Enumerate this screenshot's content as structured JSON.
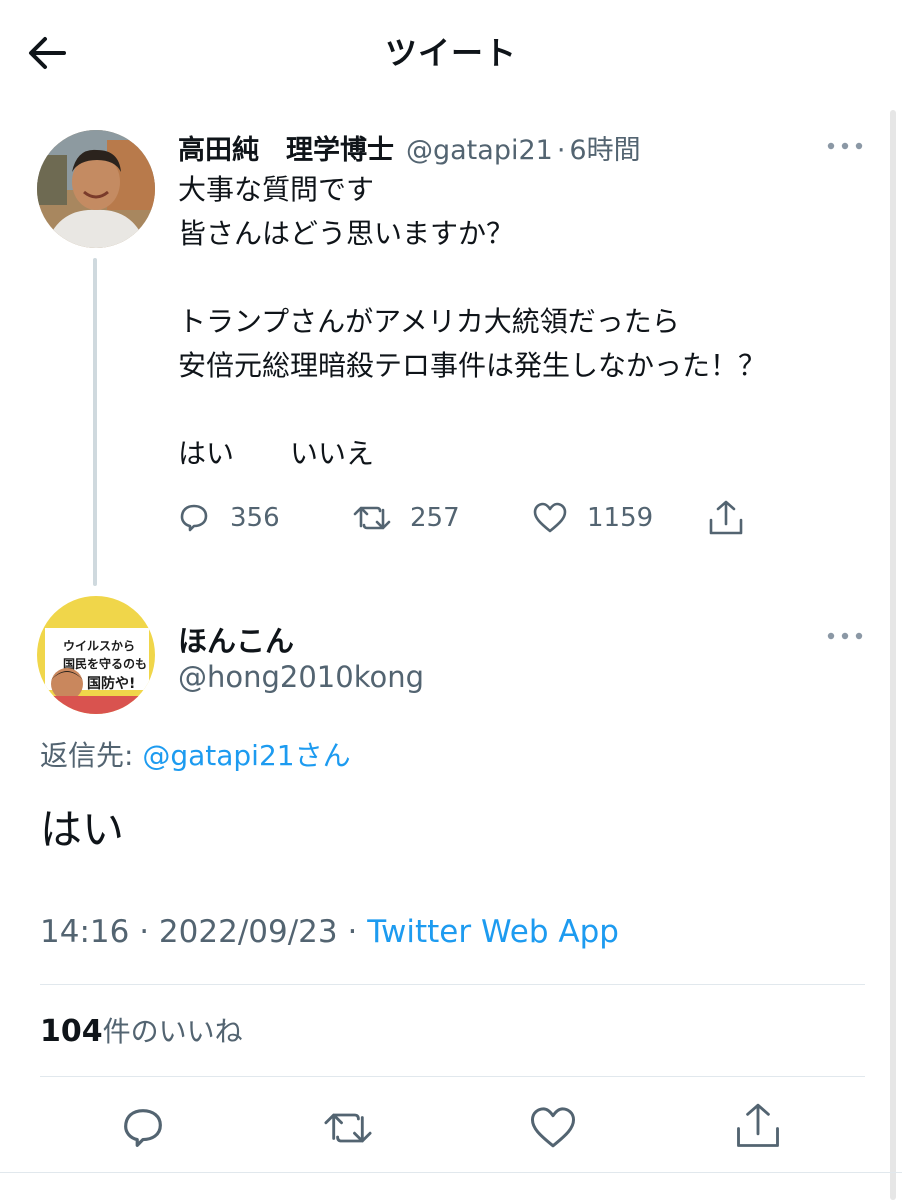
{
  "header": {
    "title": "ツイート",
    "back_icon": "arrow-left-icon"
  },
  "original_tweet": {
    "author_name": "高田純　理学博士",
    "handle": "@gatapi21",
    "separator": "·",
    "time_ago": "6時間",
    "lines": [
      "大事な質問です",
      "皆さんはどう思いますか？",
      "",
      "トランプさんがアメリカ大統領だったら",
      "安倍元総理暗殺テロ事件は発生しなかった！？",
      "",
      "はい　　いいえ"
    ],
    "replies": "356",
    "retweets": "257",
    "likes": "1159",
    "icons": {
      "reply": "reply-bubble-icon",
      "retweet": "retweet-icon",
      "like": "heart-icon",
      "share": "share-upload-icon",
      "more": "more-dots-icon"
    }
  },
  "reply_tweet": {
    "author_name": "ほんこん",
    "handle": "@hong2010kong",
    "replying_to_prefix": "返信先: ",
    "replying_to_handle": "@gatapi21",
    "replying_to_suffix": "さん",
    "text": "はい",
    "time": "14:16",
    "date": "2022/09/23",
    "source": "Twitter Web App",
    "like_count": "104",
    "like_label": "件のいいね",
    "avatar_text": {
      "line1": "ウイルスから",
      "line2": "国民を守るのも",
      "line3": "国防や!"
    }
  },
  "colors": {
    "link": "#1d9bf0",
    "secondary": "#536471",
    "text": "#0f1419",
    "divider": "#e1e8ed"
  }
}
